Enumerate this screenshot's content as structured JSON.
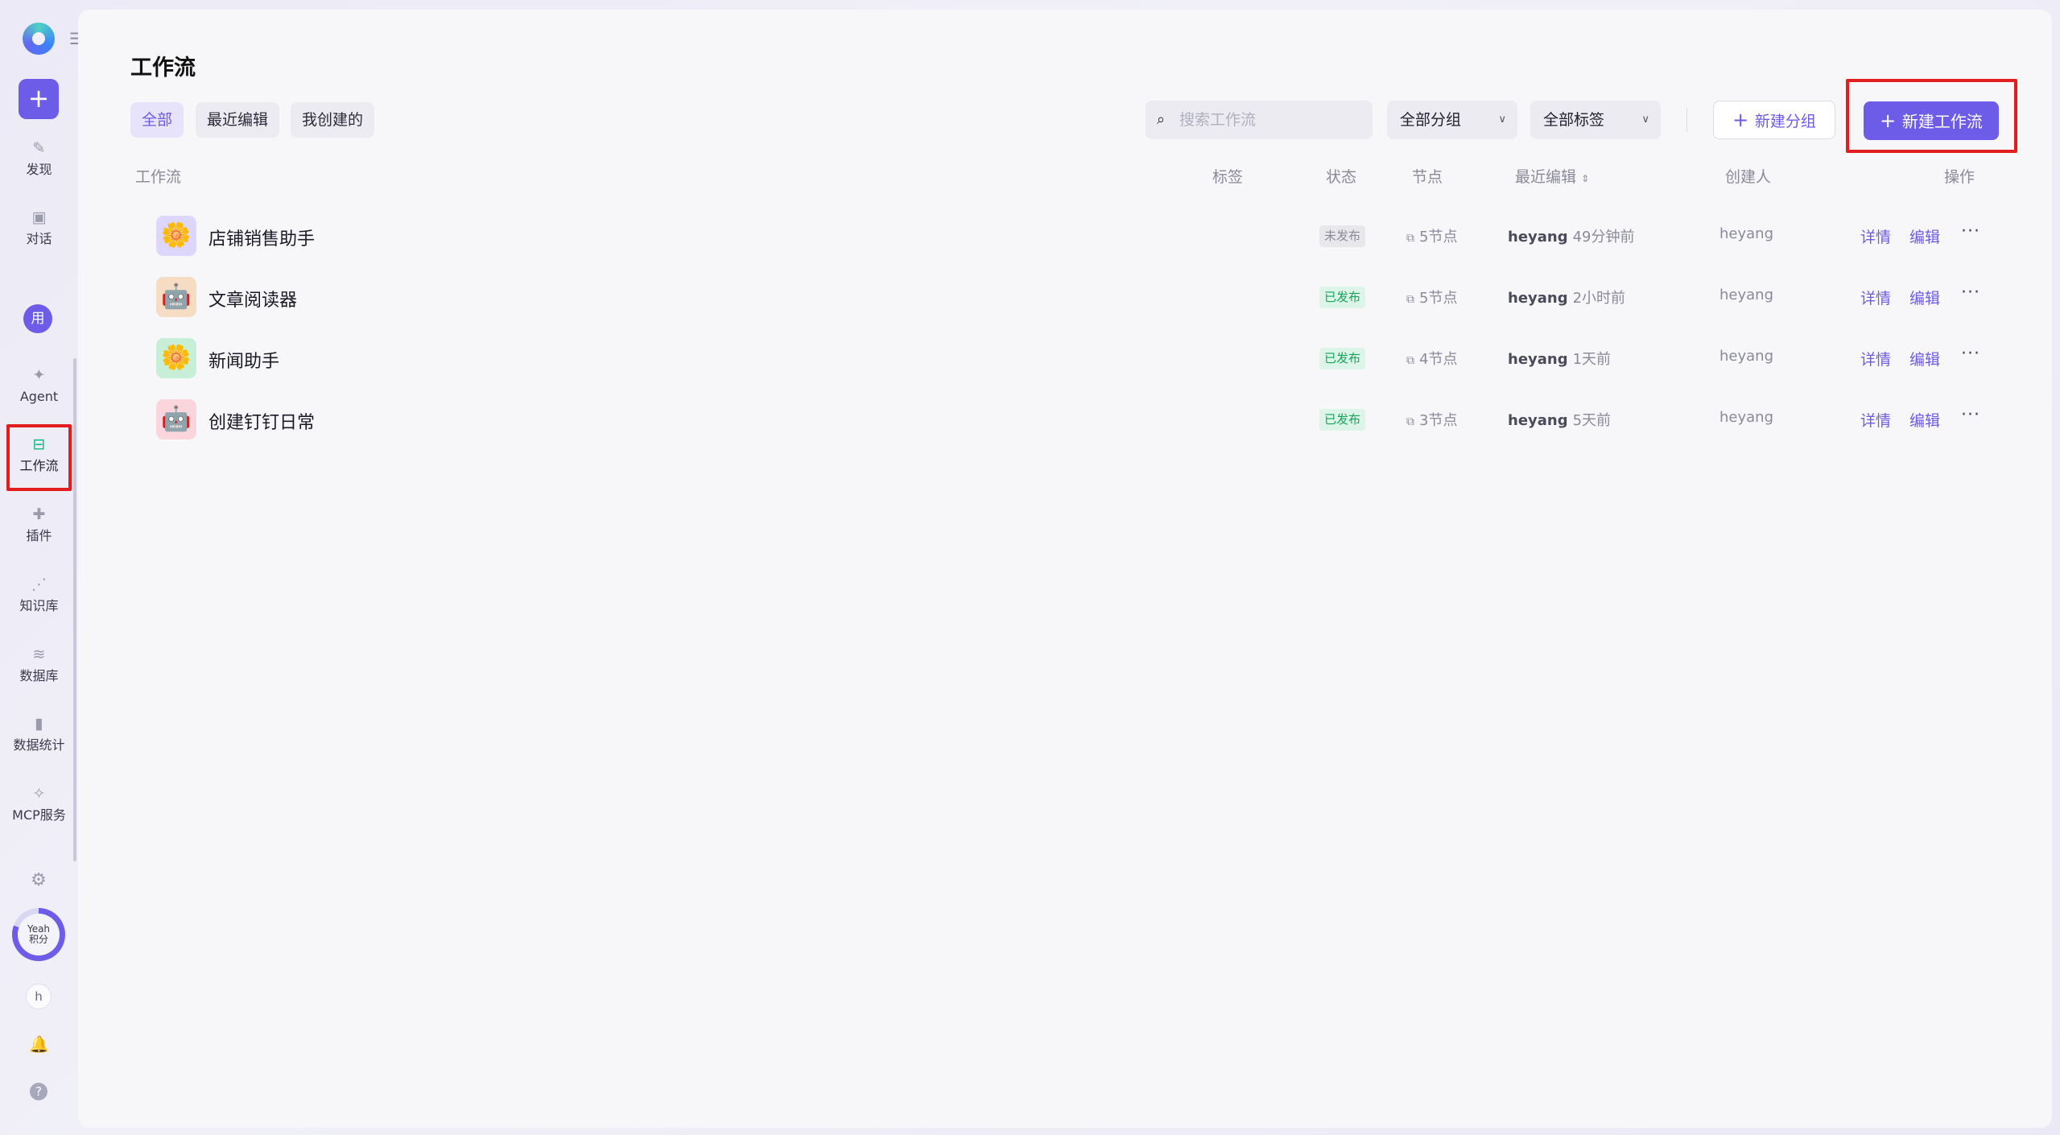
{
  "sidebar": {
    "collapse_icon": "menu-collapse-icon",
    "new_label": "+",
    "items": [
      {
        "id": "discover",
        "label": "发现",
        "icon": "discover-icon"
      },
      {
        "id": "chat",
        "label": "对话",
        "icon": "chat-icon"
      },
      {
        "id": "agent",
        "label": "Agent",
        "icon": "sparkle-icon"
      },
      {
        "id": "workflow",
        "label": "工作流",
        "icon": "workflow-icon",
        "active": true
      },
      {
        "id": "plugin",
        "label": "插件",
        "icon": "puzzle-icon"
      },
      {
        "id": "knowledge",
        "label": "知识库",
        "icon": "network-icon"
      },
      {
        "id": "database",
        "label": "数据库",
        "icon": "database-icon"
      },
      {
        "id": "stats",
        "label": "数据统计",
        "icon": "bar-chart-icon"
      },
      {
        "id": "mcp",
        "label": "MCP服务",
        "icon": "wrench-icon"
      }
    ],
    "user_badge": "用",
    "points_line1": "Yeah",
    "points_line2": "积分",
    "avatar_letter": "h"
  },
  "page": {
    "title": "工作流",
    "tabs": [
      {
        "label": "全部",
        "active": true
      },
      {
        "label": "最近编辑",
        "active": false
      },
      {
        "label": "我创建的",
        "active": false
      }
    ],
    "search": {
      "placeholder": "搜索工作流"
    },
    "group_filter": "全部分组",
    "tag_filter": "全部标签",
    "new_group_label": "新建分组",
    "new_workflow_label": "新建工作流"
  },
  "table": {
    "headers": {
      "name": "工作流",
      "tags": "标签",
      "status": "状态",
      "nodes": "节点",
      "last_edit": "最近编辑",
      "creator": "创建人",
      "actions": "操作"
    },
    "rows": [
      {
        "name": "店铺销售助手",
        "status": "未发布",
        "nodes": "5节点",
        "editor": "heyang",
        "edited": "49分钟前",
        "creator": "heyang",
        "icon": "flower-icon",
        "icon_bg": "#ddd6fe"
      },
      {
        "name": "文章阅读器",
        "status": "已发布",
        "nodes": "5节点",
        "editor": "heyang",
        "edited": "2小时前",
        "creator": "heyang",
        "icon": "robot-icon",
        "icon_bg": "#f5dcc2"
      },
      {
        "name": "新闻助手",
        "status": "已发布",
        "nodes": "4节点",
        "editor": "heyang",
        "edited": "1天前",
        "creator": "heyang",
        "icon": "flower-icon",
        "icon_bg": "#c7efd8"
      },
      {
        "name": "创建钉钉日常",
        "status": "已发布",
        "nodes": "3节点",
        "editor": "heyang",
        "edited": "5天前",
        "creator": "heyang",
        "icon": "robot-icon",
        "icon_bg": "#fbd5dc"
      }
    ],
    "detail_label": "详情",
    "edit_label": "编辑",
    "more_label": "···"
  },
  "colors": {
    "accent": "#6c5ce7",
    "highlight": "#e11d1d",
    "published": "#16a35a"
  }
}
